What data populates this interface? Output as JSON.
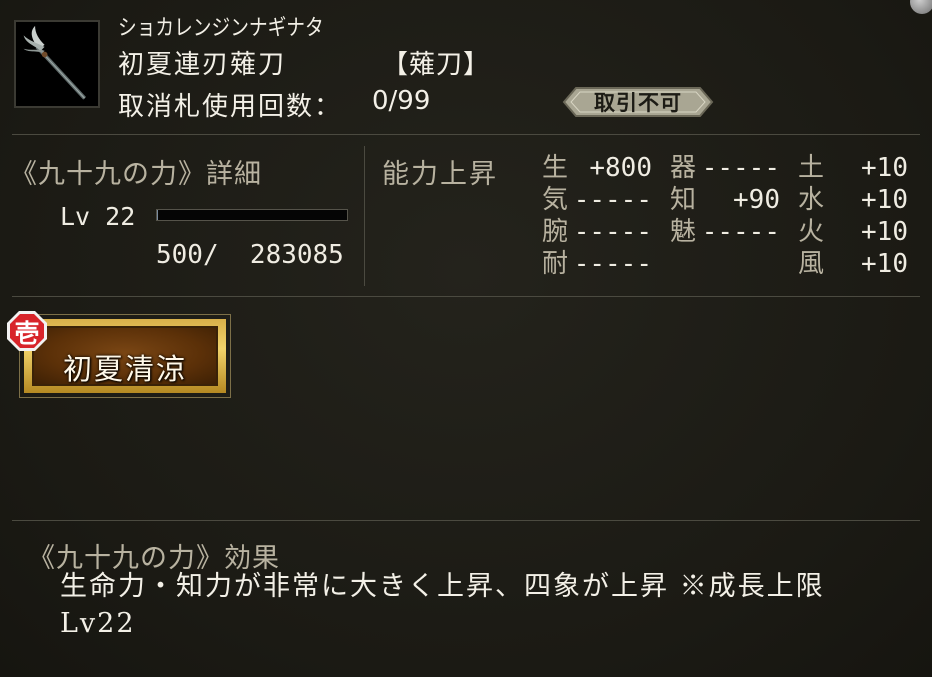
{
  "item": {
    "kana": "ショカレンジンナギナタ",
    "name": "初夏連刃薙刀",
    "type": "【薙刀】",
    "cancel_label": "取消札使用回数：",
    "cancel_value": "0/99",
    "trade_status": "取引不可"
  },
  "detail": {
    "title": "《九十九の力》詳細",
    "level_label": "Lv 22",
    "exp_text": "500/  283085",
    "exp_progress": 0.0018
  },
  "boost": {
    "title": "能力上昇",
    "stats": [
      {
        "key": "生",
        "value": "+800"
      },
      {
        "key": "気",
        "value": "-----"
      },
      {
        "key": "腕",
        "value": "-----"
      },
      {
        "key": "耐",
        "value": "-----"
      },
      {
        "key": "器",
        "value": "-----"
      },
      {
        "key": "知",
        "value": "+90"
      },
      {
        "key": "魅",
        "value": "-----"
      },
      {
        "key": "土",
        "value": "+10"
      },
      {
        "key": "水",
        "value": "+10"
      },
      {
        "key": "火",
        "value": "+10"
      },
      {
        "key": "風",
        "value": "+10"
      }
    ]
  },
  "skill": {
    "rank": "壱",
    "label": "初夏清涼"
  },
  "effect": {
    "title": "《九十九の力》効果",
    "text": "生命力・知力が非常に大きく上昇、四象が上昇 ※成長上限Lv22"
  },
  "colors": {
    "background": "#1c1b15",
    "label": "#b8b2a0",
    "text": "#efece2",
    "skill_gold": "#f1d36b",
    "rank_red": "#d8242a"
  }
}
